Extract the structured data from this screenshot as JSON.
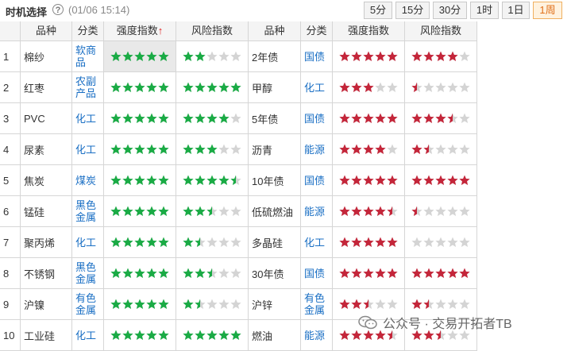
{
  "header": {
    "title": "时机选择",
    "help_icon": "?",
    "timestamp": "(01/06 15:14)",
    "timeframes": [
      {
        "label": "5分",
        "active": false
      },
      {
        "label": "15分",
        "active": false
      },
      {
        "label": "30分",
        "active": false
      },
      {
        "label": "1时",
        "active": false
      },
      {
        "label": "1日",
        "active": false
      },
      {
        "label": "1周",
        "active": true
      }
    ]
  },
  "columns": {
    "left": {
      "product": "品种",
      "category": "分类",
      "strength": "强度指数",
      "strength_arrow": "↑",
      "risk": "风险指数"
    },
    "right": {
      "product": "品种",
      "category": "分类",
      "strength": "强度指数",
      "risk": "风险指数"
    }
  },
  "colors": {
    "green": "#1aab45",
    "red": "#c4263a",
    "empty": "#d4d4d4"
  },
  "rows": [
    {
      "n": "1",
      "lp": "棉纱",
      "lc": "软商品",
      "ls": 5,
      "lr": 2,
      "rp": "2年债",
      "rc": "国债",
      "rs": 5,
      "rr": 4
    },
    {
      "n": "2",
      "lp": "红枣",
      "lc": "农副产品",
      "ls": 5,
      "lr": 5,
      "rp": "甲醇",
      "rc": "化工",
      "rs": 3,
      "rr": 0.5
    },
    {
      "n": "3",
      "lp": "PVC",
      "lc": "化工",
      "ls": 5,
      "lr": 4,
      "rp": "5年债",
      "rc": "国债",
      "rs": 5,
      "rr": 3.5
    },
    {
      "n": "4",
      "lp": "尿素",
      "lc": "化工",
      "ls": 5,
      "lr": 3,
      "rp": "沥青",
      "rc": "能源",
      "rs": 4,
      "rr": 1.5
    },
    {
      "n": "5",
      "lp": "焦炭",
      "lc": "煤炭",
      "ls": 5,
      "lr": 4.5,
      "rp": "10年债",
      "rc": "国债",
      "rs": 5,
      "rr": 5
    },
    {
      "n": "6",
      "lp": "锰硅",
      "lc": "黑色金属",
      "ls": 5,
      "lr": 2.5,
      "rp": "低硫燃油",
      "rc": "能源",
      "rs": 4.5,
      "rr": 0.5
    },
    {
      "n": "7",
      "lp": "聚丙烯",
      "lc": "化工",
      "ls": 5,
      "lr": 1.5,
      "rp": "多晶硅",
      "rc": "化工",
      "rs": 5,
      "rr": 0
    },
    {
      "n": "8",
      "lp": "不锈钢",
      "lc": "黑色金属",
      "ls": 5,
      "lr": 2.5,
      "rp": "30年债",
      "rc": "国债",
      "rs": 5,
      "rr": 5
    },
    {
      "n": "9",
      "lp": "沪镍",
      "lc": "有色金属",
      "ls": 5,
      "lr": 1.5,
      "rp": "沪锌",
      "rc": "有色金属",
      "rs": 2.5,
      "rr": 1.5
    },
    {
      "n": "10",
      "lp": "工业硅",
      "lc": "化工",
      "ls": 5,
      "lr": 5,
      "rp": "燃油",
      "rc": "能源",
      "rs": 4.5,
      "rr": 2.5
    }
  ],
  "watermark": {
    "text": "公众号 · 交易开拓者TB",
    "icon": "wechat-icon"
  }
}
